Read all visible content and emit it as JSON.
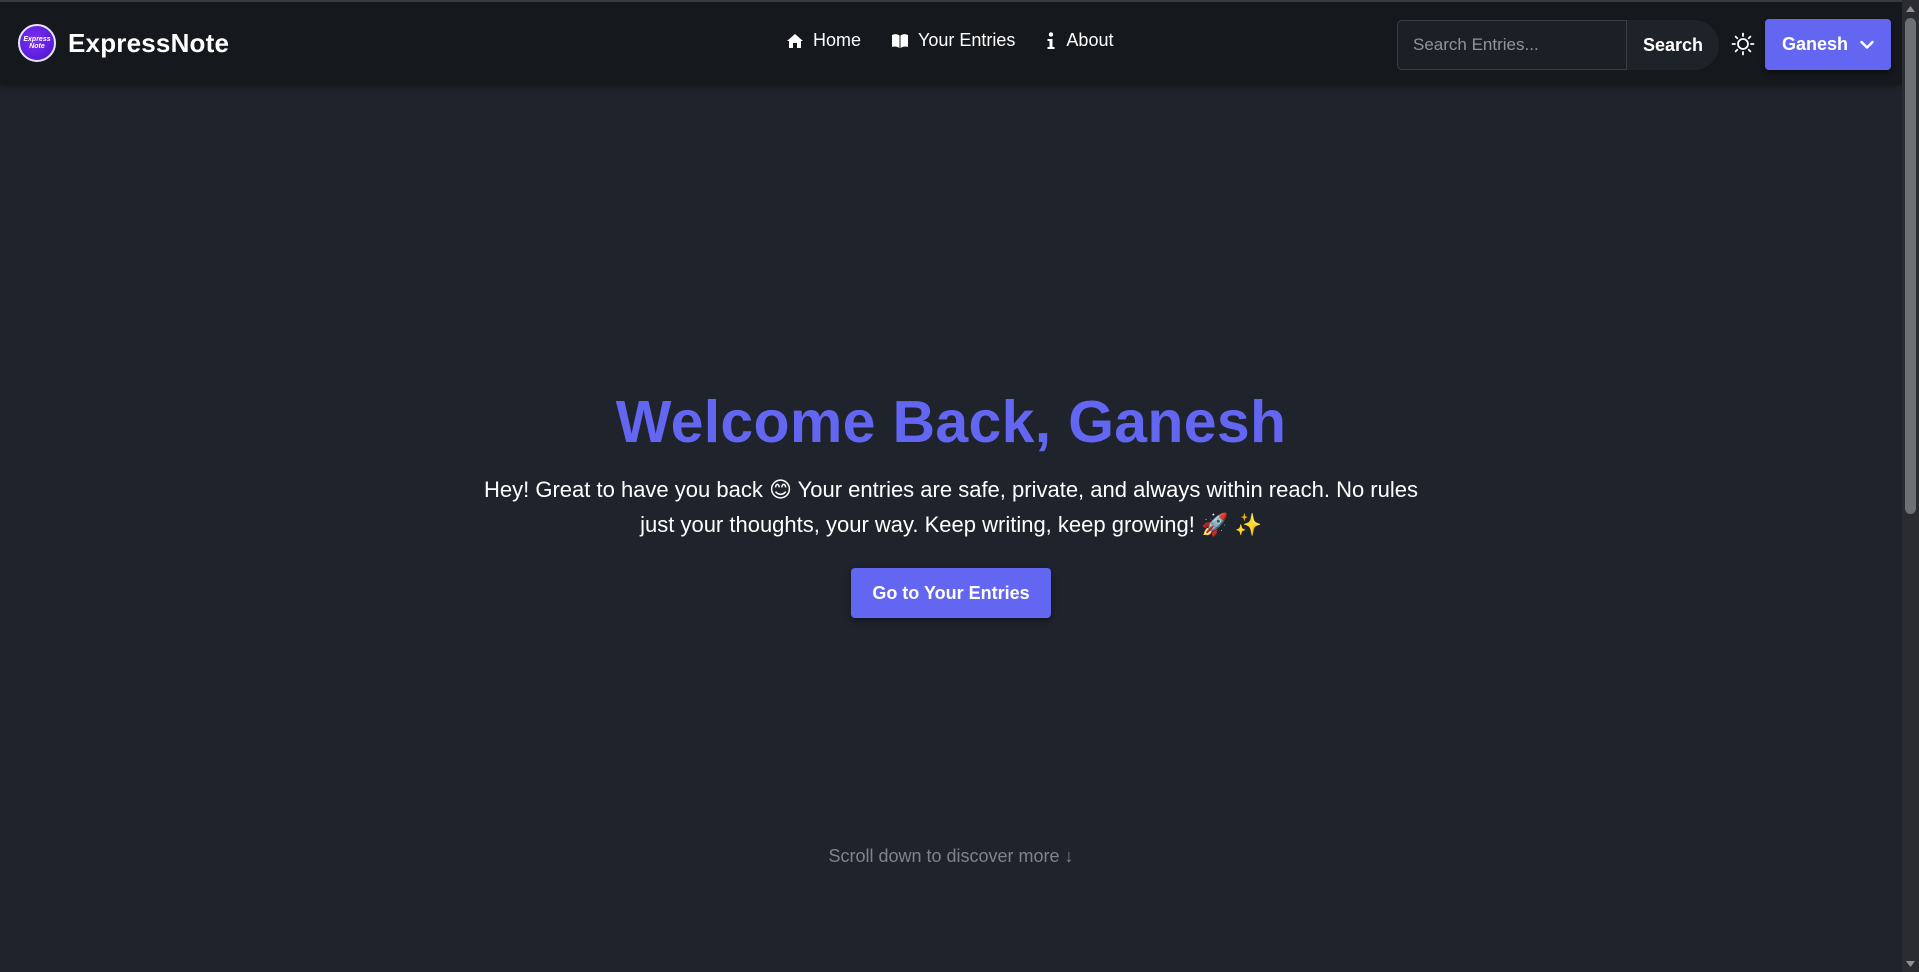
{
  "app": {
    "name": "ExpressNote",
    "logo_text_line1": "Express",
    "logo_text_line2": "Note"
  },
  "nav": {
    "items": [
      {
        "label": "Home",
        "icon": "home-icon"
      },
      {
        "label": "Your Entries",
        "icon": "book-icon"
      },
      {
        "label": "About",
        "icon": "info-icon"
      }
    ]
  },
  "search": {
    "placeholder": "Search Entries...",
    "value": "",
    "button_label": "Search"
  },
  "theme_toggle": {
    "icon": "sun-icon"
  },
  "user": {
    "name": "Ganesh",
    "icon": "chevron-down-icon"
  },
  "hero": {
    "title": "Welcome Back, Ganesh",
    "subtitle": "Hey! Great to have you back 😊 Your entries are safe, private, and always within reach. No rules just your thoughts, your way. Keep writing, keep growing! 🚀 ✨",
    "cta_label": "Go to Your Entries"
  },
  "scroll_hint": "Scroll down to discover more ↓",
  "colors": {
    "accent": "#6366f1",
    "navbar_bg": "#15181d",
    "page_bg": "#1e232c",
    "muted_text": "#7e848d"
  }
}
